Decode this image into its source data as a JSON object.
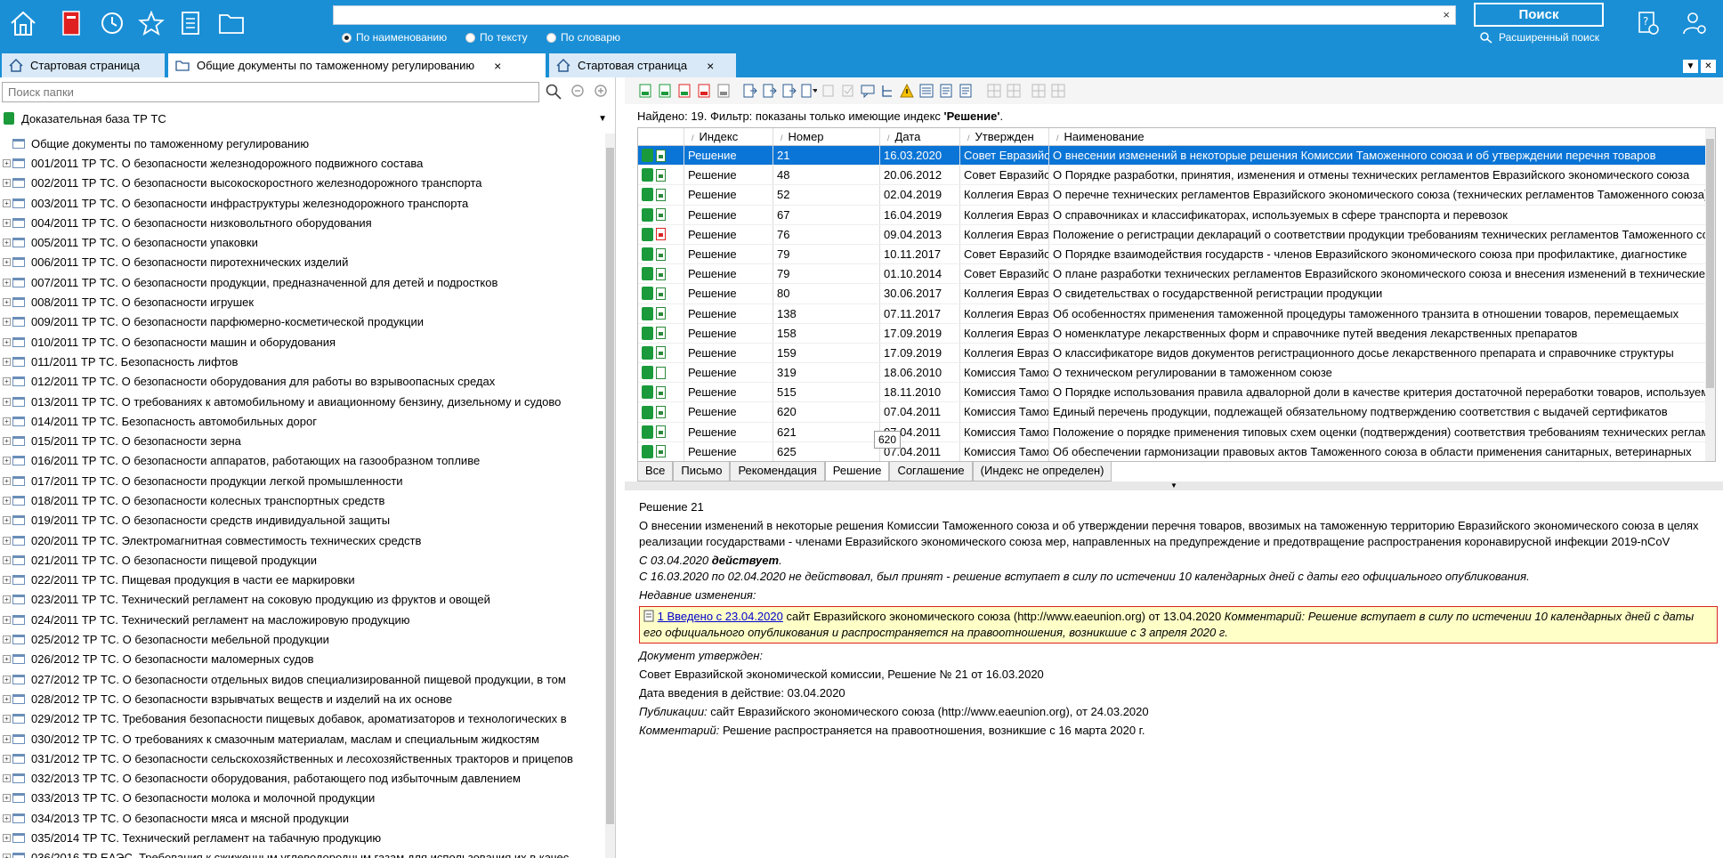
{
  "search": {
    "placeholder": "",
    "clear": "×",
    "radios": [
      "По наименованию",
      "По тексту",
      "По словарю"
    ],
    "button": "Поиск",
    "advanced": "Расширенный поиск"
  },
  "tabs": [
    {
      "label": "Стартовая страница"
    },
    {
      "label": "Общие документы по таможенному регулированию",
      "close": "×"
    },
    {
      "label": "Стартовая страница",
      "close": "×"
    }
  ],
  "left": {
    "folder_search_placeholder": "Поиск папки",
    "base": "Доказательная база ТР ТС",
    "tree": [
      "Общие документы по таможенному регулированию",
      "001/2011 ТР ТС. О безопасности железнодорожного подвижного состава",
      "002/2011 ТР ТС. О безопасности высокоскоростного железнодорожного транспорта",
      "003/2011 ТР ТС. О безопасности инфраструктуры железнодорожного транспорта",
      "004/2011 ТР ТС. О безопасности низковольтного оборудования",
      "005/2011 ТР ТС. О безопасности упаковки",
      "006/2011 ТР ТС. О безопасности пиротехнических изделий",
      "007/2011 ТР ТС. О безопасности продукции, предназначенной для детей и подростков",
      "008/2011 ТР ТС. О безопасности игрушек",
      "009/2011 ТР ТС. О безопасности парфюмерно-косметической продукции",
      "010/2011 ТР ТС. О безопасности машин и оборудования",
      "011/2011 ТР ТС. Безопасность лифтов",
      "012/2011 ТР ТС. О безопасности оборудования для работы во взрывоопасных средах",
      "013/2011 ТР ТС. О требованиях к автомобильному и авиационному бензину, дизельному и судово",
      "014/2011 ТР ТС. Безопасность автомобильных дорог",
      "015/2011 ТР ТС. О безопасности зерна",
      "016/2011 ТР ТС. О безопасности аппаратов, работающих на газообразном топливе",
      "017/2011 ТР ТС. О безопасности продукции легкой промышленности",
      "018/2011 ТР ТС. О безопасности колесных транспортных средств",
      "019/2011 ТР ТС. О безопасности средств индивидуальной защиты",
      "020/2011 ТР ТС. Электромагнитная совместимость технических средств",
      "021/2011 ТР ТС. О безопасности пищевой продукции",
      "022/2011 ТР ТС. Пищевая продукция в части ее маркировки",
      "023/2011 ТР ТС. Технический регламент на соковую продукцию из фруктов и овощей",
      "024/2011 ТР ТС. Технический регламент на масложировую продукцию",
      "025/2012 ТР ТС. О безопасности мебельной продукции",
      "026/2012 ТР ТС. О безопасности маломерных судов",
      "027/2012 ТР ТС. О безопасности отдельных видов специализированной пищевой продукции, в том",
      "028/2012 ТР ТС. О безопасности взрывчатых веществ и изделий на их основе",
      "029/2012 ТР ТС. Требования безопасности пищевых добавок, ароматизаторов и технологических в",
      "030/2012 ТР ТС. О требованиях к смазочным материалам, маслам и специальным жидкостям",
      "031/2012 ТР ТС. О безопасности сельскохозяйственных и лесохозяйственных тракторов и прицепов",
      "032/2013 ТР ТС. О безопасности оборудования, работающего под избыточным давлением",
      "033/2013 ТР ТС. О безопасности молока и молочной продукции",
      "034/2013 ТР ТС. О безопасности мяса и мясной продукции",
      "035/2014 ТР ТС. Технический регламент на табачную продукцию",
      "036/2016 ТР ЕАЭС. Требования к сжиженным углеводородным газам для использования их в качес"
    ]
  },
  "found": {
    "prefix": "Найдено: 19. Фильтр: показаны только имеющие индекс ",
    "value": "'Решение'",
    "suffix": "."
  },
  "grid": {
    "columns": [
      "Индекс",
      "Номер",
      "Дата",
      "Утвержден",
      "Наименование"
    ],
    "rows": [
      {
        "index": "Решение",
        "num": "21",
        "date": "16.03.2020",
        "by": "Совет Евразийской экономической комиссии",
        "name": "О внесении изменений в некоторые решения Комиссии Таможенного союза и об утверждении перечня товаров"
      },
      {
        "index": "Решение",
        "num": "48",
        "date": "20.06.2012",
        "by": "Совет Евразийской экономической комиссии",
        "name": "О Порядке разработки, принятия, изменения и отмены технических регламентов Евразийского экономического союза"
      },
      {
        "index": "Решение",
        "num": "52",
        "date": "02.04.2019",
        "by": "Коллегия Евразийской экономической комиссии",
        "name": "О перечне технических регламентов Евразийского экономического союза (технических регламентов Таможенного союза)"
      },
      {
        "index": "Решение",
        "num": "67",
        "date": "16.04.2019",
        "by": "Коллегия Евразийской экономической комиссии",
        "name": "О справочниках и классификаторах, используемых в сфере транспорта и перевозок"
      },
      {
        "index": "Решение",
        "num": "76",
        "date": "09.04.2013",
        "by": "Коллегия Евразийской экономической комиссии",
        "name": "Положение о регистрации деклараций о соответствии продукции требованиям технических регламентов Таможенного союза",
        "red": true
      },
      {
        "index": "Решение",
        "num": "79",
        "date": "10.11.2017",
        "by": "Совет Евразийской экономической комиссии",
        "name": "О Порядке взаимодействия государств - членов Евразийского экономического союза при профилактике, диагностике"
      },
      {
        "index": "Решение",
        "num": "79",
        "date": "01.10.2014",
        "by": "Совет Евразийской экономической комиссии",
        "name": "О плане разработки технических регламентов Евразийского экономического союза и внесения изменений в технические регламенты"
      },
      {
        "index": "Решение",
        "num": "80",
        "date": "30.06.2017",
        "by": "Коллегия Евразийской экономической комиссии",
        "name": "О свидетельствах о государственной регистрации продукции"
      },
      {
        "index": "Решение",
        "num": "138",
        "date": "07.11.2017",
        "by": "Коллегия Евразийской экономической комиссии",
        "name": "Об особенностях применения таможенной процедуры таможенного транзита в отношении товаров, перемещаемых"
      },
      {
        "index": "Решение",
        "num": "158",
        "date": "17.09.2019",
        "by": "Коллегия Евразийской экономической комиссии",
        "name": "О номенклатуре лекарственных форм и справочнике путей введения лекарственных препаратов"
      },
      {
        "index": "Решение",
        "num": "159",
        "date": "17.09.2019",
        "by": "Коллегия Евразийской экономической комиссии",
        "name": "О классификаторе видов документов регистрационного досье лекарственного препарата и справочнике структуры"
      },
      {
        "index": "Решение",
        "num": "319",
        "date": "18.06.2010",
        "by": "Комиссия Таможенного союза",
        "name": "О техническом регулировании в таможенном союзе",
        "empty": true
      },
      {
        "index": "Решение",
        "num": "515",
        "date": "18.11.2010",
        "by": "Комиссия Таможенного союза",
        "name": "О Порядке использования правила адвалорной доли в качестве критерия достаточной переработки товаров, используемого"
      },
      {
        "index": "Решение",
        "num": "620",
        "date": "07.04.2011",
        "by": "Комиссия Таможенного союза",
        "name": "Единый перечень продукции, подлежащей обязательному подтверждению соответствия с выдачей сертификатов"
      },
      {
        "index": "Решение",
        "num": "621",
        "date": "07.04.2011",
        "by": "Комиссия Таможенного союза",
        "name": "Положение о порядке применения типовых схем оценки (подтверждения) соответствия требованиям технических регламентов"
      },
      {
        "index": "Решение",
        "num": "625",
        "date": "07.04.2011",
        "by": "Комиссия Таможенного союза",
        "name": "Об обеспечении гармонизации правовых актов Таможенного союза в области применения санитарных, ветеринарных"
      }
    ]
  },
  "tooltip": "620",
  "filter_tabs": [
    "Все",
    "Письмо",
    "Рекомендация",
    "Решение",
    "Соглашение",
    "(Индекс не определен)"
  ],
  "detail": {
    "title": "Решение 21",
    "text": "О внесении изменений в некоторые решения Комиссии Таможенного союза и об утверждении перечня товаров, ввозимых на таможенную территорию Евразийского экономического союза в целях реализации государствами - членами Евразийского экономического союза мер, направленных на предупреждение и предотвращение распространения коронавирусной инфекции 2019-nCoV",
    "status_prefix": "С 03.04.2020 ",
    "status_bold": "действует",
    "status_history": "С 16.03.2020 по 02.04.2020 не действовал, был принят - решение вступает в силу по истечении 10 календарных дней с даты его официального опубликования.",
    "recent_label": "Недавние изменения:",
    "change_link": "1  Введено с 23.04.2020",
    "change_source": " сайт Евразийского экономического союза (http://www.eaeunion.org) от 13.04.2020 ",
    "change_comment": "Комментарий: Решение вступает в силу по истечении 10 календарных дней с даты его официального опубликования и распространяется на правоотношения, возникшие с 3 апреля 2020 г.",
    "approved_label": "Документ утвержден:",
    "approved": "Совет Евразийской экономической комиссии, Решение № 21 от 16.03.2020",
    "effective": "Дата введения в действие: 03.04.2020",
    "pub_label": "Публикации:",
    "pub": " сайт Евразийского экономического союза (http://www.eaeunion.org), от 24.03.2020",
    "comment_label": "Комментарий:",
    "comment": " Решение распространяется на правоотношения, возникшие с 16 марта 2020 г."
  }
}
